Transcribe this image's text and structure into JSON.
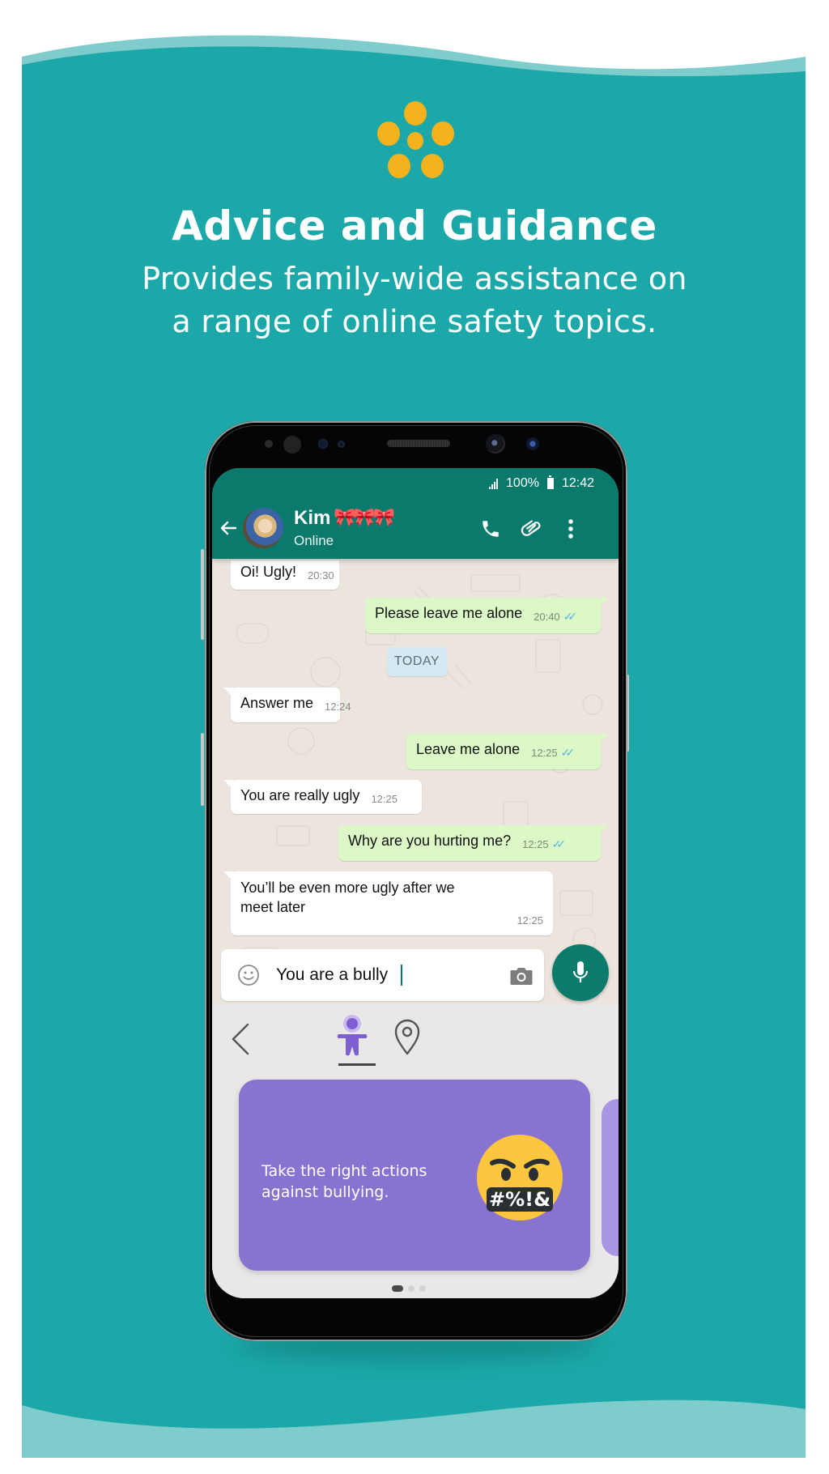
{
  "colors": {
    "background_teal": "#1ca8a8",
    "wave_light": "#7fcccc",
    "accent_yellow": "#f6b21c",
    "header_green": "#0a7a6d",
    "incoming_bubble": "#ffffff",
    "outgoing_bubble": "#dcf8c6",
    "card_purple": "#8973d1",
    "read_ticks": "#4fb6ec"
  },
  "hero": {
    "icon": "five-dots-flower-icon",
    "title": "Advice and Guidance",
    "subtitle_lines": [
      "Provides family-wide assistance on",
      "a range of online safety topics."
    ]
  },
  "phone": {
    "status_bar": {
      "signal_icon": "signal-icon",
      "battery_percent": "100%",
      "battery_icon": "battery-icon",
      "time": "12:42"
    },
    "chat_header": {
      "back_icon": "arrow-left-icon",
      "contact_name": "Kim",
      "name_emoji": "🎀🎀🎀",
      "contact_status": "Online",
      "actions": [
        "phone-icon",
        "paperclip-icon",
        "more-vertical-icon"
      ]
    },
    "messages": [
      {
        "direction": "in",
        "text": "Oi! Ugly!",
        "time": "20:30"
      },
      {
        "direction": "out",
        "text": "Please leave me alone",
        "time": "20:40",
        "status": "read"
      },
      {
        "direction": "divider",
        "text": "TODAY"
      },
      {
        "direction": "in",
        "text": "Answer me",
        "time": "12:24"
      },
      {
        "direction": "out",
        "text": "Leave me alone",
        "time": "12:25",
        "status": "read"
      },
      {
        "direction": "in",
        "text": "You are really ugly",
        "time": "12:25"
      },
      {
        "direction": "out",
        "text": "Why are you hurting me?",
        "time": "12:25",
        "status": "read"
      },
      {
        "direction": "in",
        "text": "You’ll be even more ugly after we meet later",
        "time": "12:25"
      }
    ],
    "read_ticks_glyph": "✓✓",
    "composer": {
      "emoji_icon": "smiley-icon",
      "value": "You are a bully",
      "camera_icon": "camera-icon",
      "mic_icon": "microphone-icon"
    },
    "keyboard_panel": {
      "back_icon": "chevron-left-icon",
      "tabs": [
        {
          "icon": "guide-figure-icon",
          "active": true
        },
        {
          "icon": "location-pin-icon",
          "active": false
        }
      ],
      "card": {
        "text": "Take the right actions against bullying.",
        "emoji": "angry-face-symbols-icon",
        "emoji_text": "#%!&"
      },
      "pager": {
        "current": 1,
        "total": 3
      }
    }
  }
}
